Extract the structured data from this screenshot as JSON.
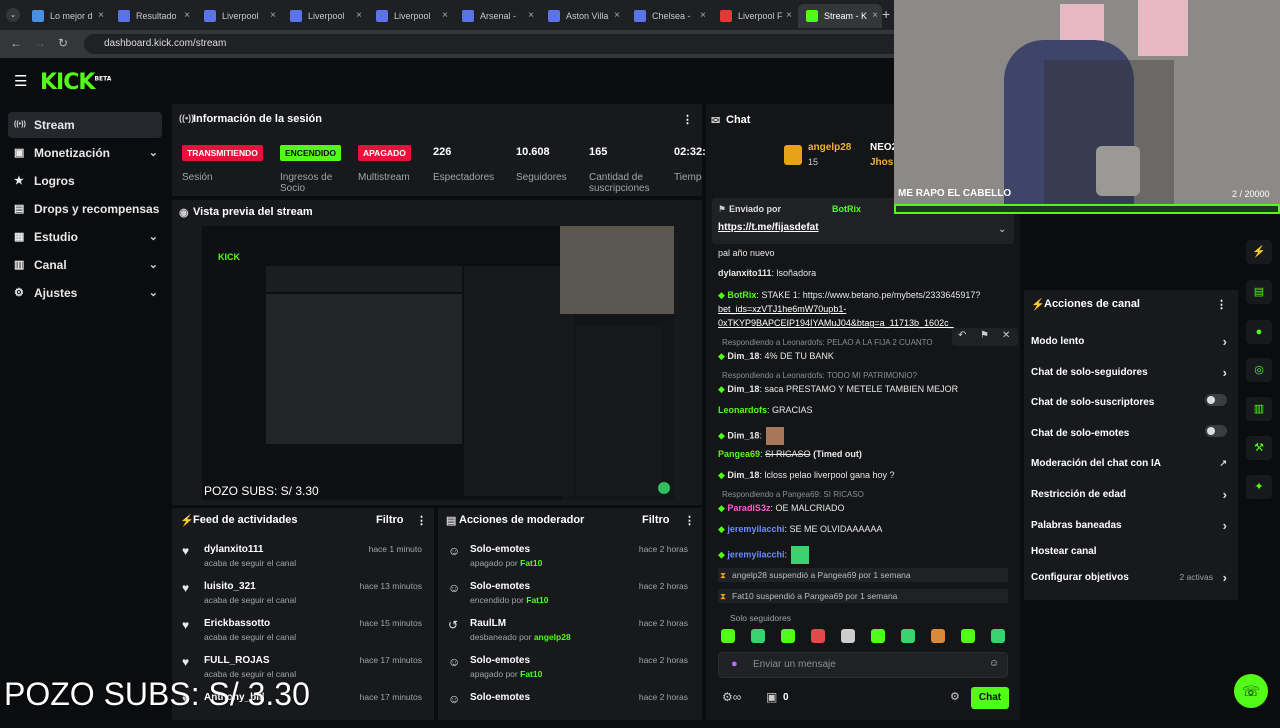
{
  "browser": {
    "tabs": [
      {
        "label": "Lo mejor d",
        "color": "#4a90e2"
      },
      {
        "label": "Resultado",
        "color": "#5a74e8"
      },
      {
        "label": "Liverpool",
        "color": "#5a74e8"
      },
      {
        "label": "Liverpool",
        "color": "#5a74e8"
      },
      {
        "label": "Liverpool",
        "color": "#5a74e8"
      },
      {
        "label": "Arsenal -",
        "color": "#5a74e8"
      },
      {
        "label": "Aston Villa",
        "color": "#5a74e8"
      },
      {
        "label": "Chelsea -",
        "color": "#5a74e8"
      },
      {
        "label": "Liverpool F",
        "color": "#e53935"
      },
      {
        "label": "Stream - K",
        "color": "#53fc18"
      }
    ],
    "url": "dashboard.kick.com/stream"
  },
  "brand": {
    "logo": "KICK",
    "beta": "BETA",
    "accent": "#53fc18"
  },
  "sidebar": {
    "items": [
      {
        "label": "Stream",
        "icon": "broadcast-icon",
        "chevron": false
      },
      {
        "label": "Monetización",
        "icon": "money-icon",
        "chevron": true
      },
      {
        "label": "Logros",
        "icon": "trophy-icon",
        "chevron": false
      },
      {
        "label": "Drops y recompensas",
        "icon": "gift-icon",
        "chevron": false
      },
      {
        "label": "Estudio",
        "icon": "studio-icon",
        "chevron": true
      },
      {
        "label": "Canal",
        "icon": "channel-icon",
        "chevron": true
      },
      {
        "label": "Ajustes",
        "icon": "gear-icon",
        "chevron": true
      }
    ]
  },
  "session": {
    "title": "Información de la sesión",
    "stats": [
      {
        "badge": "TRANSMITIENDO",
        "label": "Sesión",
        "badge_bg": "#e9113c",
        "badge_fg": "#ffffff"
      },
      {
        "badge": "ENCENDIDO",
        "label": "Ingresos de Socio",
        "badge_bg": "#53fc18",
        "badge_fg": "#0b0c0e"
      },
      {
        "badge": "APAGADO",
        "label": "Multistream",
        "badge_bg": "#e9113c",
        "badge_fg": "#ffffff"
      },
      {
        "value": "226",
        "label": "Espectadores"
      },
      {
        "value": "10.608",
        "label": "Seguidores"
      },
      {
        "value": "165",
        "label": "Cantidad de suscripciones"
      },
      {
        "value": "02:32:",
        "label": "Tiempo en vivo"
      }
    ]
  },
  "preview": {
    "title": "Vista previa del stream",
    "overlay": "POZO SUBS: S/ 3.30"
  },
  "feed": {
    "title": "Feed de actividades",
    "filter": "Filtro",
    "items": [
      {
        "name": "dylanxito111",
        "sub": "acaba de seguir el canal",
        "time": "hace 1 minuto"
      },
      {
        "name": "luisito_321",
        "sub": "acaba de seguir el canal",
        "time": "hace 13 minutos"
      },
      {
        "name": "Erickbassotto",
        "sub": "acaba de seguir el canal",
        "time": "hace 15 minutos"
      },
      {
        "name": "FULL_ROJAS",
        "sub": "acaba de seguir el canal",
        "time": "hace 17 minutos"
      },
      {
        "name": "Anthony_bill",
        "sub": "",
        "time": "hace 17 minutos"
      }
    ]
  },
  "modactions": {
    "title": "Acciones de moderador",
    "filter": "Filtro",
    "items": [
      {
        "name": "Solo-emotes",
        "sub": "apagado por",
        "by": "Fat10",
        "time": "hace 2 horas"
      },
      {
        "name": "Solo-emotes",
        "sub": "encendido por",
        "by": "Fat10",
        "time": "hace 2 horas"
      },
      {
        "name": "RaulLM",
        "sub": "desbaneado por",
        "by": "angelp28",
        "time": "hace 2 horas"
      },
      {
        "name": "Solo-emotes",
        "sub": "apagado por",
        "by": "Fat10",
        "time": "hace 2 horas"
      },
      {
        "name": "Solo-emotes",
        "sub": "",
        "by": "",
        "time": "hace 2 horas"
      }
    ]
  },
  "chat": {
    "title": "Chat",
    "pinned": {
      "sent_by": "Enviado por",
      "bot": "BotRix",
      "link": "https://t.me/fijasdefat"
    },
    "leaders": [
      {
        "name": "angelp28",
        "count": "15"
      },
      {
        "name": "NEO2"
      },
      {
        "name": "Jhos"
      }
    ],
    "messages": [
      {
        "type": "plain",
        "text": "pal año nuevo"
      },
      {
        "type": "msg",
        "user": "dylanxito111",
        "color": "#e8e8e8",
        "text": "lsoñadora"
      },
      {
        "type": "msg",
        "user": "BotRix",
        "color": "#53fc18",
        "text": "STAKE 1: https://www.betano.pe/mybets/2333645917?"
      },
      {
        "type": "link",
        "text": "bet_ids=xzVTJ1he6mW70upb1-"
      },
      {
        "type": "link",
        "text": "0xTKYP9BAPCEIP194IYAMuJ04&btag=a_11713b_1602c_"
      },
      {
        "type": "reply",
        "text": "Respondiendo a Leonardofs: PELAO A LA FIJA 2 CUANTO"
      },
      {
        "type": "msg",
        "user": "Dim_18",
        "color": "#e8e8e8",
        "text": "4% DE TU BANK"
      },
      {
        "type": "reply",
        "text": "Respondiendo a Leonardofs: TODO MI PATRIMONIO?"
      },
      {
        "type": "msg",
        "user": "Dim_18",
        "color": "#e8e8e8",
        "text": "saca PRESTAMO Y METELE TAMBIEN MEJOR"
      },
      {
        "type": "msg",
        "user": "Leonardofs",
        "color": "#53fc18",
        "text": "GRACIAS"
      },
      {
        "type": "msg",
        "user": "Dim_18",
        "color": "#e8e8e8",
        "text": ""
      },
      {
        "type": "msg",
        "user": "Pangea69",
        "color": "#53fc18",
        "text": "SI RICASO",
        "extra": "(Timed out)"
      },
      {
        "type": "msg",
        "user": "Dim_18",
        "color": "#e8e8e8",
        "text": "lcloss pelao liverpool gana hoy ?"
      },
      {
        "type": "reply",
        "text": "Respondiendo a Pangea69: SI RICASO"
      },
      {
        "type": "msg",
        "user": "ParadiS3z",
        "color": "#ff5ad6",
        "text": "OE MALCRIADO"
      },
      {
        "type": "msg",
        "user": "jeremyilacchi",
        "color": "#6c8cff",
        "text": "SE ME OLVIDAAAAAA"
      },
      {
        "type": "msg",
        "user": "jeremyilacchi",
        "color": "#6c8cff",
        "text": ""
      },
      {
        "type": "mod",
        "text": "angelp28 suspendió a Pangea69 por 1 semana"
      },
      {
        "type": "mod",
        "text": "Fat10 suspendió a Pangea69 por 1 semana"
      }
    ],
    "suggested": "Solo seguidores",
    "input_placeholder": "Enviar un mensaje",
    "count": "0",
    "send": "Chat"
  },
  "overlay": {
    "caption": "ME RAPO EL CABELLO",
    "counter": "2 / 20000"
  },
  "channel_actions": {
    "title": "Acciones de canal",
    "items": [
      {
        "label": "Modo lento",
        "kind": "chevron"
      },
      {
        "label": "Chat de solo-seguidores",
        "kind": "chevron"
      },
      {
        "label": "Chat de solo-suscriptores",
        "kind": "toggle"
      },
      {
        "label": "Chat de solo-emotes",
        "kind": "toggle"
      },
      {
        "label": "Moderación del chat con IA",
        "kind": "link"
      },
      {
        "label": "Restricción de edad",
        "kind": "chevron"
      },
      {
        "label": "Palabras baneadas",
        "kind": "chevron"
      },
      {
        "label": "Hostear canal",
        "kind": "none"
      },
      {
        "label": "Configurar objetivos",
        "kind": "chevron",
        "extra": "2 activas"
      }
    ]
  },
  "bottom_overlay": "POZO SUBS: S/ 3.30"
}
